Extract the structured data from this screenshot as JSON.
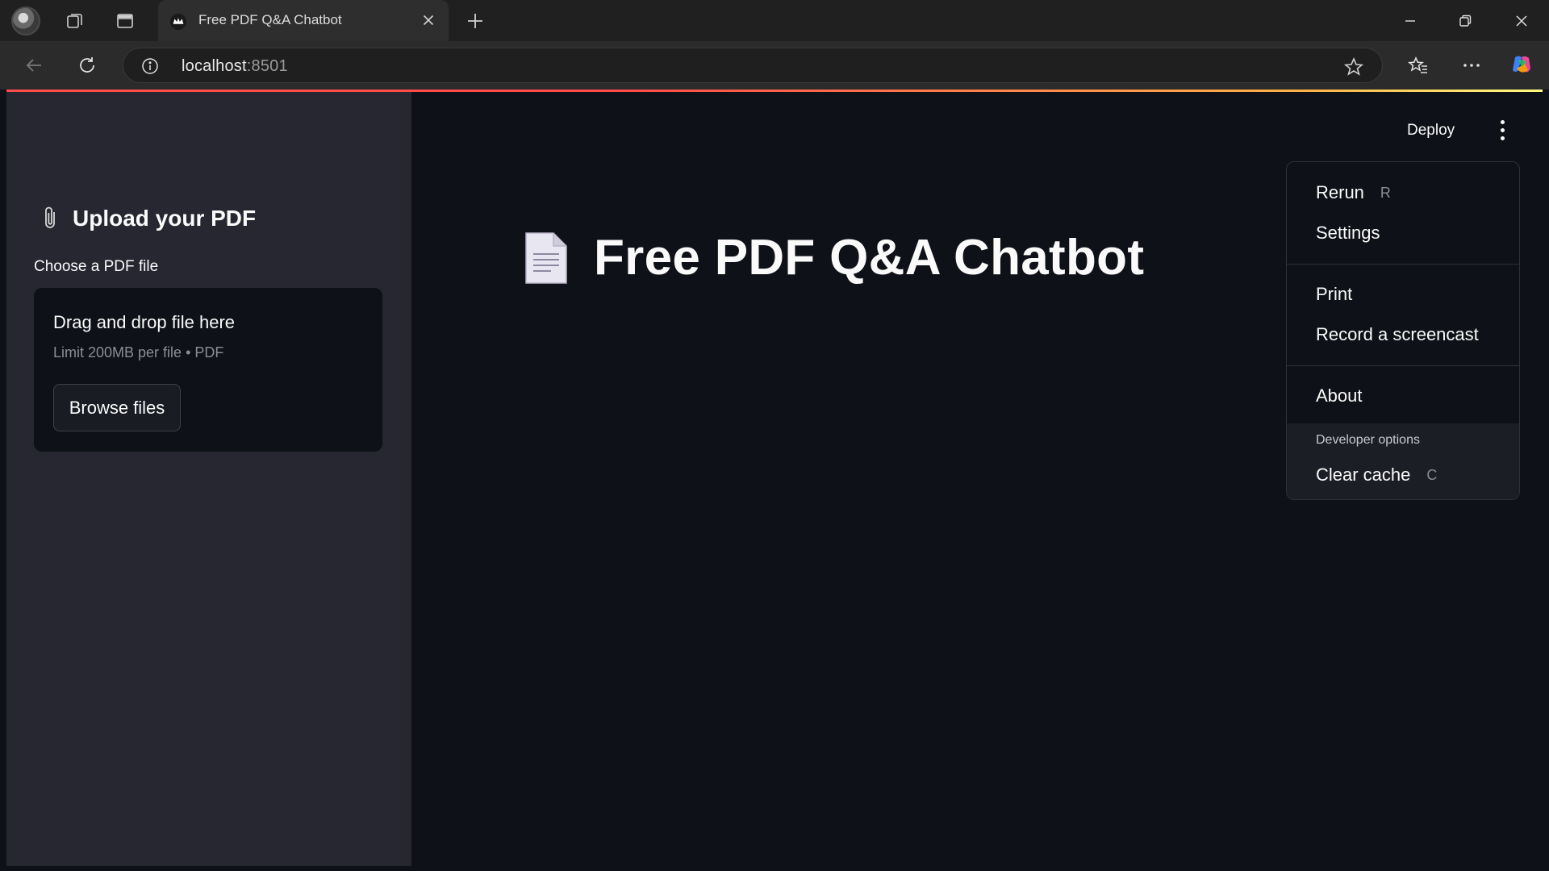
{
  "browser": {
    "tab_title": "Free PDF Q&A Chatbot",
    "url_host": "localhost",
    "url_port": ":8501"
  },
  "sidebar": {
    "title": "Upload your PDF",
    "uploader_label": "Choose a PDF file",
    "dropzone_title": "Drag and drop file here",
    "dropzone_limit": "Limit 200MB per file • PDF",
    "browse_button": "Browse files"
  },
  "main": {
    "title": "Free PDF Q&A Chatbot"
  },
  "header": {
    "deploy_label": "Deploy"
  },
  "menu": {
    "items": [
      {
        "label": "Rerun",
        "shortcut": "R"
      },
      {
        "label": "Settings",
        "shortcut": ""
      },
      {
        "label": "Print",
        "shortcut": ""
      },
      {
        "label": "Record a screencast",
        "shortcut": ""
      },
      {
        "label": "About",
        "shortcut": ""
      }
    ],
    "developer_label": "Developer options",
    "clear_cache": {
      "label": "Clear cache",
      "shortcut": "C"
    }
  },
  "colors": {
    "app_bg": "#0e1117",
    "sidebar_bg": "#262730",
    "accent_red": "#ff4b4b",
    "accent_yellow": "#fffd80"
  }
}
